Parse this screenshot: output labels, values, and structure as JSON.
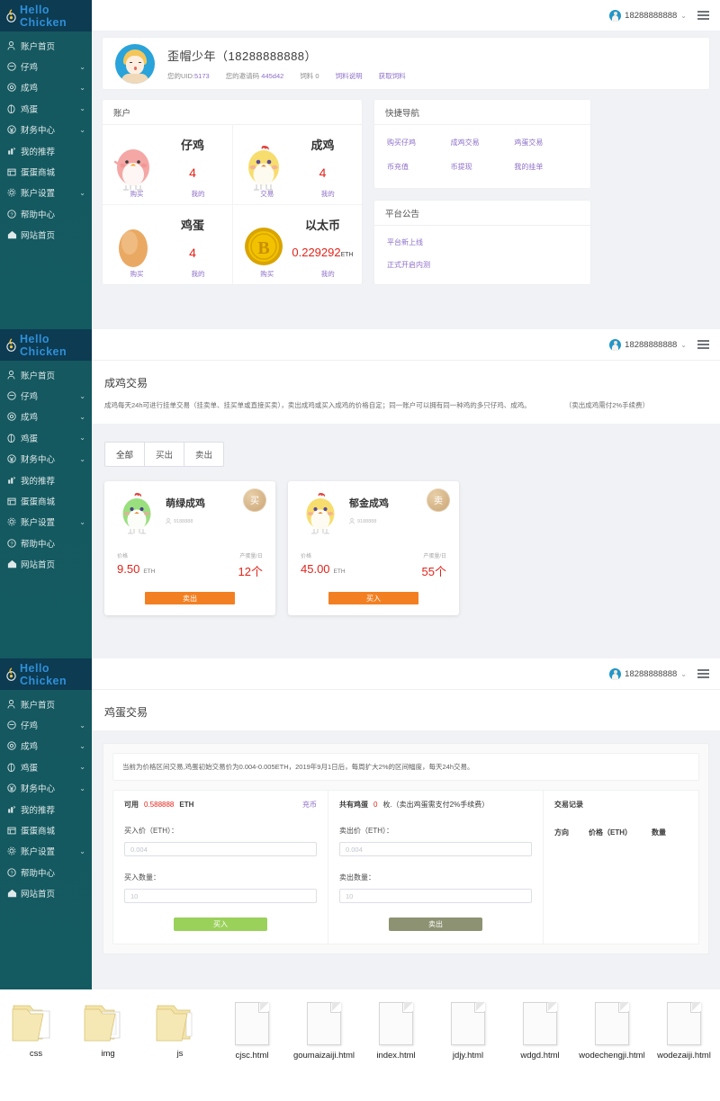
{
  "brand": {
    "logo": "chick-logo-icon",
    "text": "Hello  Chicken"
  },
  "sidebar": {
    "items": [
      {
        "label": "账户首页",
        "icon": "user-icon",
        "caret": false
      },
      {
        "label": "仔鸡",
        "icon": "chick-icon",
        "caret": true
      },
      {
        "label": "成鸡",
        "icon": "hen-icon",
        "caret": true
      },
      {
        "label": "鸡蛋",
        "icon": "egg-icon",
        "caret": true
      },
      {
        "label": "财务中心",
        "icon": "finance-icon",
        "caret": true
      },
      {
        "label": "我的推荐",
        "icon": "share-icon",
        "caret": false
      },
      {
        "label": "蛋蛋商城",
        "icon": "shop-icon",
        "caret": false
      },
      {
        "label": "账户设置",
        "icon": "gear-icon",
        "caret": true
      },
      {
        "label": "帮助中心",
        "icon": "help-icon",
        "caret": false
      },
      {
        "label": "网站首页",
        "icon": "home-icon",
        "caret": false
      }
    ],
    "caret_glyph": "⌄"
  },
  "topbar": {
    "username": "18288888888",
    "caret": "⌄",
    "menu_icon": "hamburger-icon",
    "avatar": "user-avatar"
  },
  "profile": {
    "name": "歪帽少年（18288888888）",
    "uid_label": "您的UID:",
    "uid_value": "5173",
    "invite_label": "您的邀请码",
    "invite_value": "445d42",
    "feed_label": "饲料",
    "feed_value": "0",
    "feed_desc_link": "饲料说明",
    "feed_get_link": "获取饲料"
  },
  "account_card": {
    "title": "账户",
    "assets": [
      {
        "name": "仔鸡",
        "art": "pink-chick-icon",
        "value": "4",
        "unit": "",
        "links": [
          "购买",
          "我的"
        ]
      },
      {
        "name": "成鸡",
        "art": "yellow-hen-icon",
        "value": "4",
        "unit": "",
        "links": [
          "交易",
          "我的"
        ]
      },
      {
        "name": "鸡蛋",
        "art": "egg-icon",
        "value": "4",
        "unit": "",
        "links": [
          "购买",
          "我的"
        ]
      },
      {
        "name": "以太币",
        "art": "coin-icon",
        "value": "0.229292",
        "unit": "ETH",
        "links": [
          "购买",
          "我的"
        ]
      }
    ]
  },
  "quick_nav": {
    "title": "快捷导航",
    "links": [
      "购买仔鸡",
      "成鸡交易",
      "鸡蛋交易",
      "币充值",
      "币提现",
      "我的挂单"
    ]
  },
  "notice": {
    "title": "平台公告",
    "items": [
      "平台新上线",
      "正式开启内测"
    ]
  },
  "chengji": {
    "title": "成鸡交易",
    "desc": "成鸡每天24h可进行挂单交易（挂卖单、挂买单或直接买卖），卖出成鸡或买入成鸡的价格自定；同一账户可以拥有同一种鸡的多只仔鸡、成鸡。",
    "desc_fee": "（卖出成鸡需付2%手续费）",
    "tabs": [
      "全部",
      "买出",
      "卖出"
    ],
    "active_tab": "全部",
    "cards": [
      {
        "name": "萌绿成鸡",
        "art": "green-hen-icon",
        "owner": "9188888",
        "badge": "买",
        "price_label": "价格",
        "price": "9.50",
        "price_unit": "ETH",
        "yield_label": "产蛋量/日",
        "yield": "12个",
        "button": "卖出"
      },
      {
        "name": "郁金成鸡",
        "art": "gold-hen-icon",
        "owner": "9188888",
        "badge": "卖",
        "price_label": "价格",
        "price": "45.00",
        "price_unit": "ETH",
        "yield_label": "产蛋量/日",
        "yield": "55个",
        "button": "买入"
      }
    ]
  },
  "jidan": {
    "title": "鸡蛋交易",
    "note": "当前为价格区间交易,鸡蛋初始交易价为0.004-0.005ETH，2019年9月1日后，每周扩大2%的区间幅度，每天24h交易。",
    "buy_col": {
      "avail_label": "可用",
      "avail_value": "0.588888",
      "avail_unit": "ETH",
      "recharge": "充币",
      "price_label": "买入价（ETH）：",
      "price_placeholder": "0.004",
      "qty_label": "买入数量：",
      "qty_placeholder": "10",
      "button": "买入"
    },
    "sell_col": {
      "own_label": "共有鸡蛋",
      "own_value": "0",
      "own_suffix": "枚.（卖出鸡蛋需支付2%手续费）",
      "price_label": "卖出价（ETH）：",
      "price_placeholder": "0.004",
      "qty_label": "卖出数量：",
      "qty_placeholder": "10",
      "button": "卖出"
    },
    "records": {
      "title": "交易记录",
      "columns": [
        "方向",
        "价格（ETH）",
        "数量"
      ],
      "rows": []
    }
  },
  "files": [
    {
      "name": "css",
      "type": "folder"
    },
    {
      "name": "img",
      "type": "folder"
    },
    {
      "name": "js",
      "type": "folder"
    },
    {
      "name": "cjsc.html",
      "type": "file"
    },
    {
      "name": "goumaizaiji.html",
      "type": "file"
    },
    {
      "name": "index.html",
      "type": "file"
    },
    {
      "name": "jdjy.html",
      "type": "file"
    },
    {
      "name": "wdgd.html",
      "type": "file"
    },
    {
      "name": "wodechengji.html",
      "type": "file"
    },
    {
      "name": "wodezaiji.html",
      "type": "file"
    }
  ],
  "colors": {
    "sidebar": "#14585f",
    "brand": "#0c3b52",
    "accent": "#8d6fc9",
    "danger": "#e2231a",
    "orange": "#f28022",
    "green": "#9ad15b",
    "olive": "#8d9272"
  }
}
